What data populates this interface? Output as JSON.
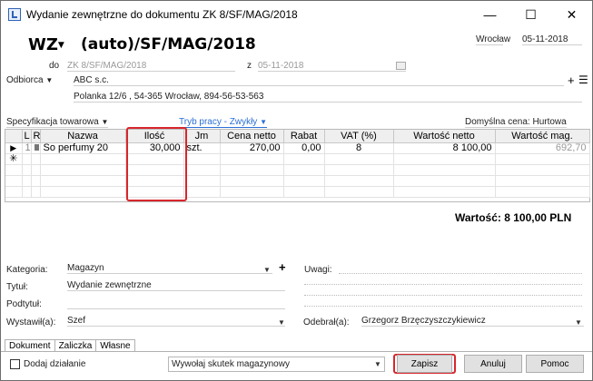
{
  "window": {
    "title": "Wydanie zewnętrzne do dokumentu ZK 8/SF/MAG/2018",
    "controls": [
      "—",
      "☐",
      "✕"
    ]
  },
  "header": {
    "doc_type": "WZ",
    "doc_number": "(auto)/SF/MAG/2018",
    "city": "Wrocław",
    "date": "05-11-2018",
    "do_label": "do",
    "do_value": "ZK 8/SF/MAG/2018",
    "z_label": "z",
    "z_value": "05-11-2018"
  },
  "recipient": {
    "label": "Odbiorca",
    "name": "ABC s.c.",
    "address": "Polanka  12/6 , 54-365 Wrocław, 894-56-53-563"
  },
  "spec": {
    "label": "Specyfikacja towarowa",
    "work_mode": "Tryb pracy - Zwykły",
    "default_price": "Domyślna cena: Hurtowa"
  },
  "table": {
    "columns": [
      "L",
      "R",
      "Nazwa",
      "Ilość",
      "Jm",
      "Cena netto",
      "Rabat",
      "VAT (%)",
      "Wartość netto",
      "Wartość mag."
    ],
    "rows": [
      {
        "lp": "1",
        "name": "So perfumy 20",
        "qty": "30,000",
        "unit": "szt.",
        "price": "270,00",
        "discount": "0,00",
        "vat": "8",
        "net_value": "8 100,00",
        "mag_value": "692,70"
      }
    ],
    "new_row_marker": "✳",
    "current_row_marker": "▶"
  },
  "total": "Wartość: 8 100,00 PLN",
  "form": {
    "kategoria_label": "Kategoria:",
    "kategoria_value": "Magazyn",
    "tytul_label": "Tytuł:",
    "tytul_value": "Wydanie zewnętrzne",
    "podtytul_label": "Podtytuł:",
    "podtytul_value": "",
    "wystawil_label": "Wystawił(a):",
    "wystawil_value": "Szef",
    "uwagi_label": "Uwagi:",
    "odebral_label": "Odebrał(a):",
    "odebral_value": "Grzegorz Brzęczyszczykiewicz"
  },
  "tabs": [
    "Dokument",
    "Zaliczka",
    "Własne"
  ],
  "footer": {
    "add_action": "Dodaj działanie",
    "effect_select": "Wywołaj skutek magazynowy",
    "save": "Zapisz",
    "cancel": "Anuluj",
    "help": "Pomoc"
  },
  "colors": {
    "highlight_red": "#d8262c",
    "link_blue": "#2b6fd6"
  }
}
